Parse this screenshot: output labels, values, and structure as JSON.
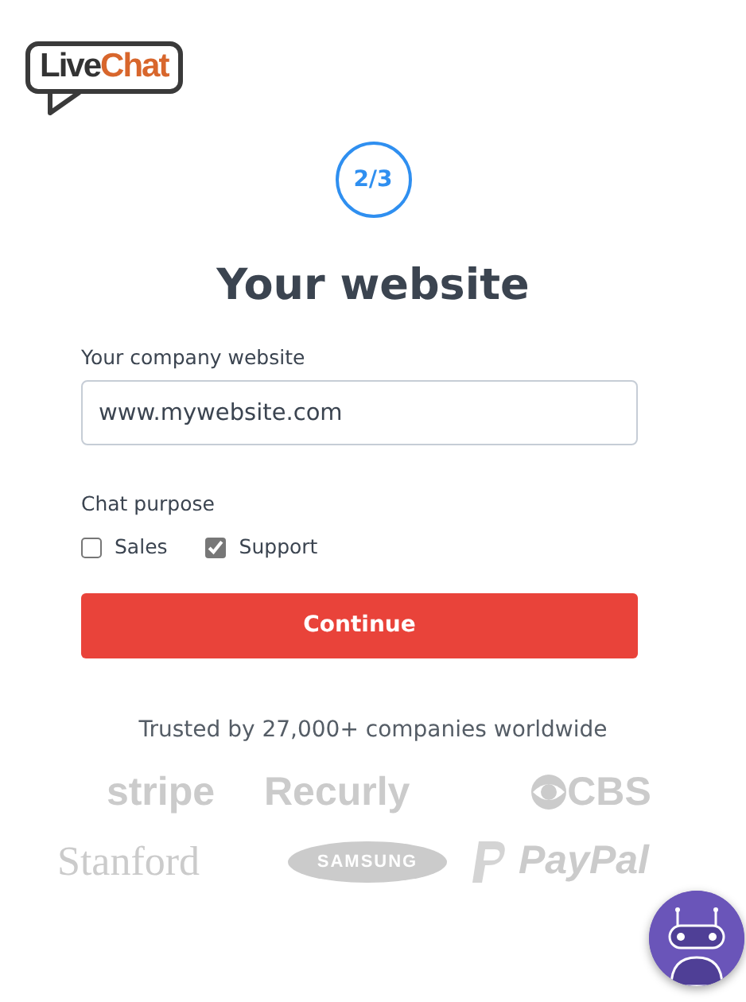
{
  "logo": {
    "parts": [
      "Live",
      "Chat"
    ]
  },
  "step": "2/3",
  "title": "Your website",
  "website_field": {
    "label": "Your company website",
    "value": "www.mywebsite.com"
  },
  "chat_purpose": {
    "label": "Chat purpose",
    "options": [
      {
        "label": "Sales",
        "checked": false
      },
      {
        "label": "Support",
        "checked": true
      }
    ]
  },
  "continue_button": "Continue",
  "trusted_text": "Trusted by 27,000+ companies worldwide",
  "partners": [
    {
      "text": "stripe",
      "kind": "sans"
    },
    {
      "text": "Recurly",
      "kind": "sans"
    },
    {
      "text": "CBS",
      "kind": "eye"
    },
    {
      "text": "Stanford",
      "kind": "serif"
    },
    {
      "text": "SAMSUNG",
      "kind": "oval"
    },
    {
      "text": "PayPal",
      "kind": "pmark"
    }
  ]
}
